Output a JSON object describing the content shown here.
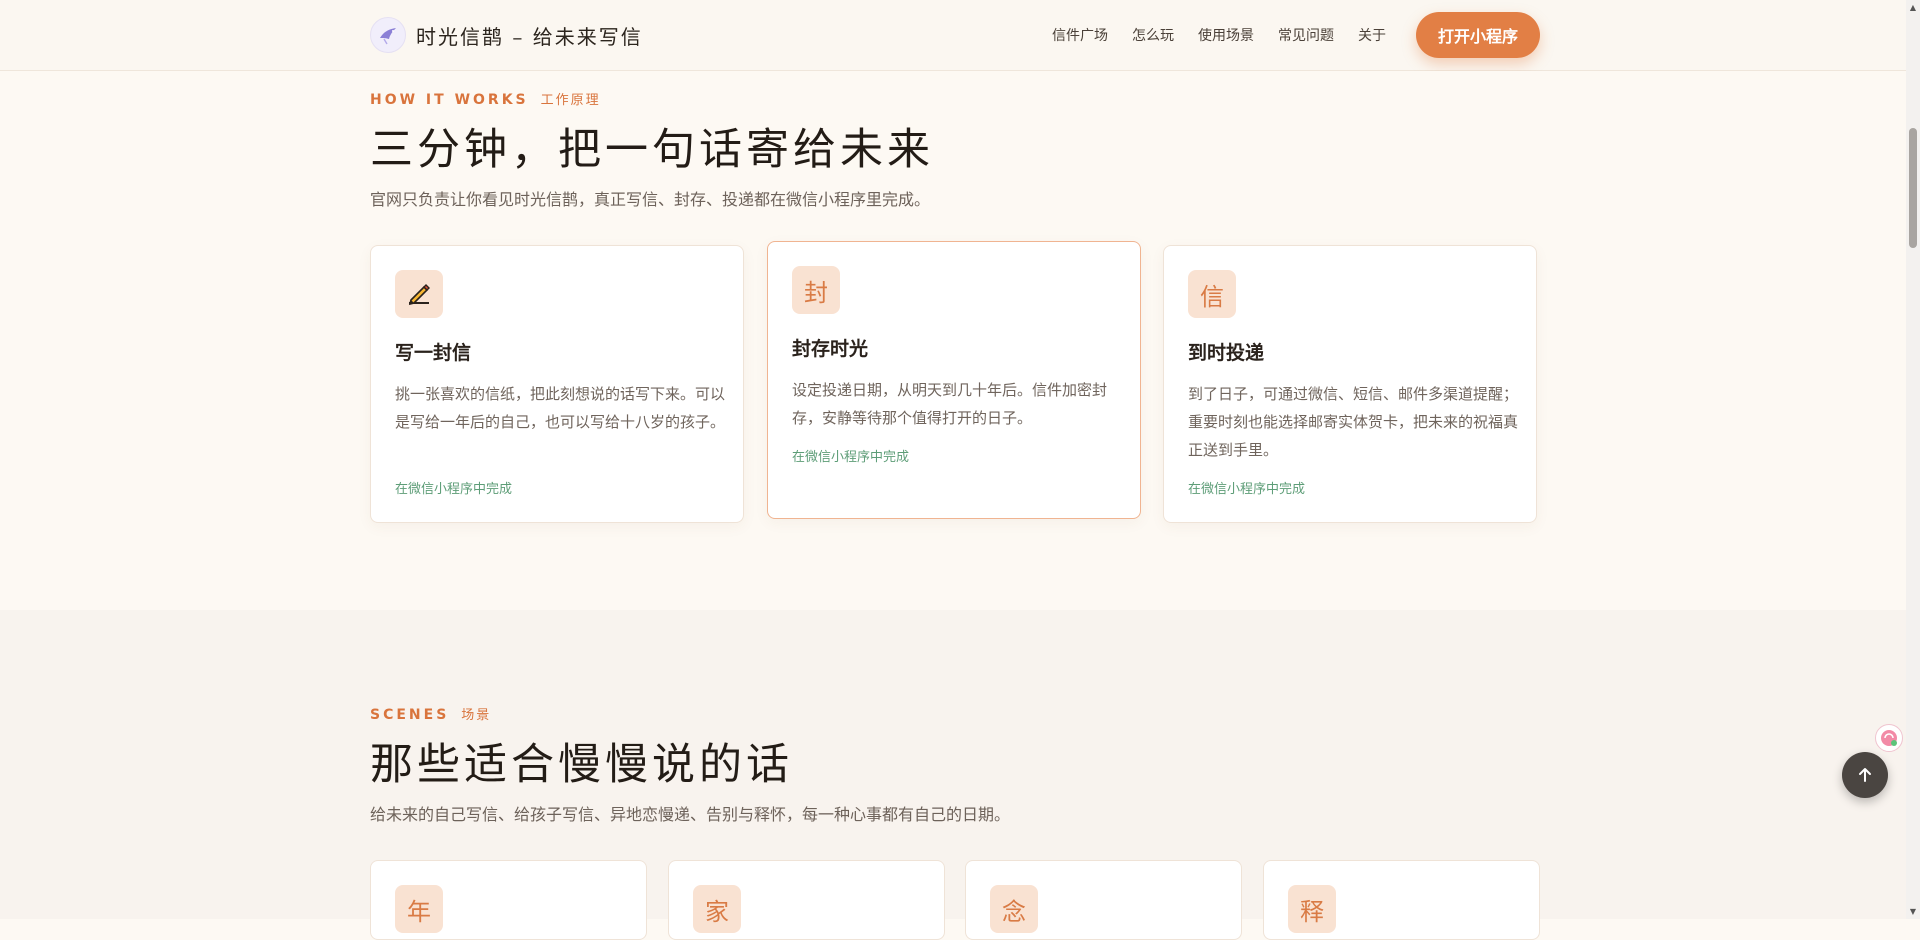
{
  "header": {
    "brand_title": "时光信鹊 – 给未来写信",
    "nav": [
      "信件广场",
      "怎么玩",
      "使用场景",
      "常见问题",
      "关于"
    ],
    "cta_label": "打开小程序"
  },
  "how": {
    "eyebrow_en": "HOW IT WORKS",
    "eyebrow_cn": "工作原理",
    "title": "三分钟，把一句话寄给未来",
    "lead": "官网只负责让你看见时光信鹊，真正写信、封存、投递都在微信小程序里完成。",
    "cards": [
      {
        "icon": "pencil-writing-icon",
        "title": "写一封信",
        "desc": "挑一张喜欢的信纸，把此刻想说的话写下来。可以是写给一年后的自己，也可以写给十八岁的孩子。",
        "note": "在微信小程序中完成"
      },
      {
        "badge": "封",
        "title": "封存时光",
        "desc": "设定投递日期，从明天到几十年后。信件加密封存，安静等待那个值得打开的日子。",
        "note": "在微信小程序中完成"
      },
      {
        "badge": "信",
        "title": "到时投递",
        "desc": "到了日子，可通过微信、短信、邮件多渠道提醒；重要时刻也能选择邮寄实体贺卡，把未来的祝福真正送到手里。",
        "note": "在微信小程序中完成"
      }
    ]
  },
  "scenes": {
    "eyebrow_en": "SCENES",
    "eyebrow_cn": "场景",
    "title": "那些适合慢慢说的话",
    "lead": "给未来的自己写信、给孩子写信、异地恋慢递、告别与释怀，每一种心事都有自己的日期。",
    "badges": [
      "年",
      "家",
      "念",
      "释"
    ]
  },
  "colors": {
    "accent": "#e27f45",
    "note_green": "#5d9d77",
    "background": "#fdf9f3"
  }
}
